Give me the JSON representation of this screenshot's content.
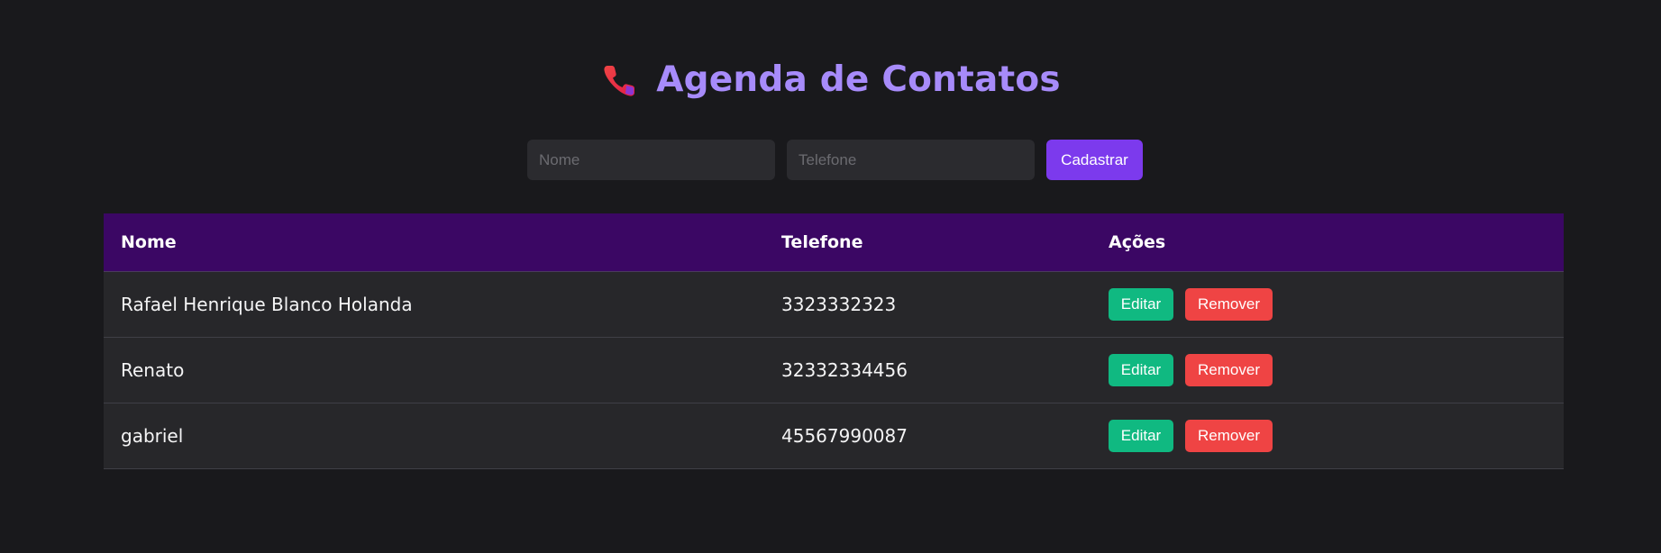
{
  "header": {
    "icon": "phone-icon",
    "title": "Agenda de Contatos"
  },
  "form": {
    "name_placeholder": "Nome",
    "name_value": "",
    "phone_placeholder": "Telefone",
    "phone_value": "",
    "submit_label": "Cadastrar"
  },
  "table": {
    "columns": [
      "Nome",
      "Telefone",
      "Ações"
    ],
    "rows": [
      {
        "name": "Rafael Henrique Blanco Holanda",
        "phone": "3323332323",
        "edit_label": "Editar",
        "remove_label": "Remover"
      },
      {
        "name": "Renato",
        "phone": "32332334456",
        "edit_label": "Editar",
        "remove_label": "Remover"
      },
      {
        "name": "gabriel",
        "phone": "45567990087",
        "edit_label": "Editar",
        "remove_label": "Remover"
      }
    ]
  },
  "colors": {
    "background": "#19191c",
    "title": "#a78bfa",
    "primary": "#7c3aed",
    "table_header": "#3b0764",
    "edit": "#10b981",
    "remove": "#ef4444"
  }
}
